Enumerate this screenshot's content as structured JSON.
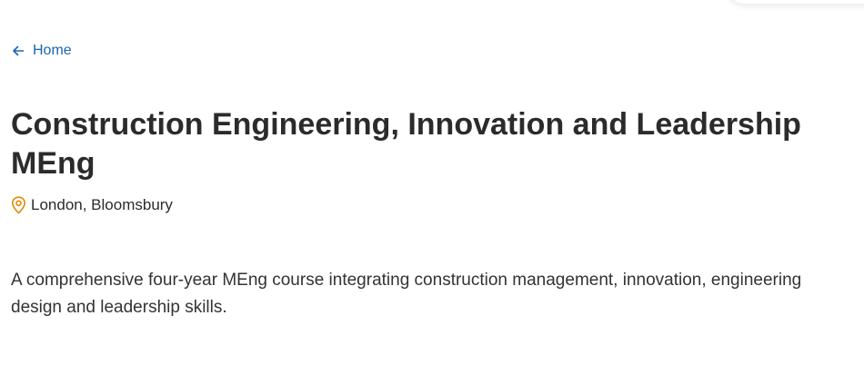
{
  "nav": {
    "back_label": "Home",
    "back_icon": "arrow-left-icon"
  },
  "course": {
    "title": "Construction Engineering, Innovation and Leadership MEng",
    "location": "London, Bloomsbury",
    "location_icon": "map-pin-icon",
    "summary": "A comprehensive four-year MEng course integrating construction management, innovation, engineering design and leadership skills."
  },
  "colors": {
    "link": "#1d65ad",
    "pin": "#e08a00",
    "text": "#2b2b2b"
  }
}
